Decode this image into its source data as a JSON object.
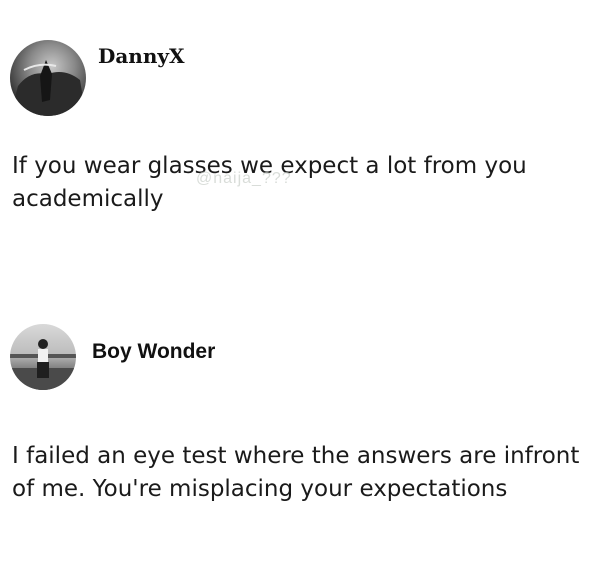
{
  "posts": [
    {
      "author": "DannyX",
      "text": "If you wear glasses we expect a lot from you academically"
    },
    {
      "author": "Boy Wonder",
      "text": "I failed an eye test where the answers are infront of me. You're misplacing your expectations"
    }
  ],
  "watermark": "@naija_???"
}
